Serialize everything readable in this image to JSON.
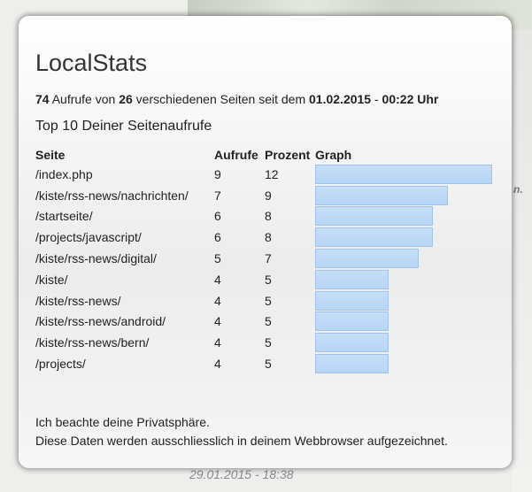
{
  "background": {
    "date_text": "29.01.2015 - 18:38",
    "edge_text": "n."
  },
  "panel": {
    "title": "LocalStats",
    "summary": {
      "hits": "74",
      "hits_label": "Aufrufe von",
      "pages": "26",
      "pages_label": "verschiedenen Seiten seit dem",
      "since_date": "01.02.2015",
      "separator": "-",
      "since_time": "00:22 Uhr"
    },
    "subtitle": "Top 10 Deiner Seitenaufrufe",
    "table": {
      "headers": [
        "Seite",
        "Aufrufe",
        "Prozent",
        "Graph"
      ],
      "rows": [
        {
          "page": "/index.php",
          "hits": "9",
          "percent": "12",
          "value": 12
        },
        {
          "page": "/kiste/rss-news/nachrichten/",
          "hits": "7",
          "percent": "9",
          "value": 9
        },
        {
          "page": "/startseite/",
          "hits": "6",
          "percent": "8",
          "value": 8
        },
        {
          "page": "/projects/javascript/",
          "hits": "6",
          "percent": "8",
          "value": 8
        },
        {
          "page": "/kiste/rss-news/digital/",
          "hits": "5",
          "percent": "7",
          "value": 7
        },
        {
          "page": "/kiste/",
          "hits": "4",
          "percent": "5",
          "value": 5
        },
        {
          "page": "/kiste/rss-news/",
          "hits": "4",
          "percent": "5",
          "value": 5
        },
        {
          "page": "/kiste/rss-news/android/",
          "hits": "4",
          "percent": "5",
          "value": 5
        },
        {
          "page": "/kiste/rss-news/bern/",
          "hits": "4",
          "percent": "5",
          "value": 5
        },
        {
          "page": "/projects/",
          "hits": "4",
          "percent": "5",
          "value": 5
        }
      ]
    },
    "notice": {
      "line1": "Ich beachte deine Privatsphäre.",
      "line2": "Diese Daten werden ausschliesslich in deinem Webbrowser aufgezeichnet."
    }
  },
  "colors": {
    "bar_fill": "#b7d5f5",
    "bar_border": "#9fc3ea"
  }
}
